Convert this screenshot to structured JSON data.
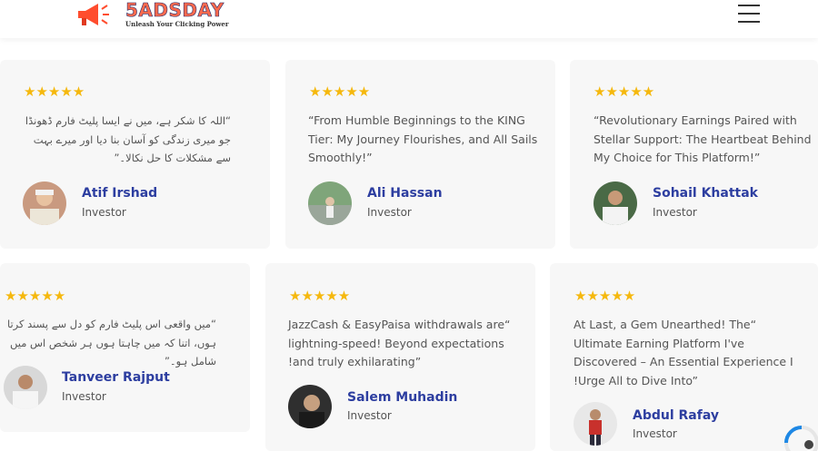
{
  "header": {
    "logo_title": "5ADSDAY",
    "logo_tagline": "Unleash Your Clicking Power",
    "menu_icon": "hamburger-menu-icon"
  },
  "colors": {
    "star": "#f5b80d",
    "name": "#2d3ea0",
    "card_bg": "#f7f7f7",
    "loader": "#1e88e5"
  },
  "testimonials": [
    {
      "rating": "★★★★★",
      "quote": "“اللہ کا شکر ہے، میں نے ایسا پلیٹ فارم ڈھونڈا جو میری زندگی کو آسان بنا دیا اور میرے بہت سے مشکلات کا حل نکالا۔”",
      "name": "Atif Irshad",
      "role": "Investor"
    },
    {
      "rating": "★★★★★",
      "quote": "“From Humble Beginnings to the KING Tier: My Journey Flourishes, and All Sails Smoothly!”",
      "name": "Ali Hassan",
      "role": "Investor"
    },
    {
      "rating": "★★★★★",
      "quote": "“Revolutionary Earnings Paired with Stellar Support: The Heartbeat Behind My Choice for This Platform!”",
      "name": "Sohail Khattak",
      "role": "Investor"
    },
    {
      "rating": "★★★★★",
      "quote": "“میں واقعی اس پلیٹ فارم کو دل سے پسند کرتا ہوں، اتنا کہ میں چاہتا ہوں ہر شخص اس میں شامل ہو۔”",
      "name": "Tanveer Rajput",
      "role": "Investor"
    },
    {
      "rating": "★★★★★",
      "quote": "JazzCash & EasyPaisa withdrawals are“ lightning-speed! Beyond expectations !and truly exhilarating”",
      "name": "Salem Muhadin",
      "role": "Investor"
    },
    {
      "rating": "★★★★★",
      "quote": "At Last, a Gem Unearthed! The“ Ultimate Earning Platform I've Discovered – An Essential Experience I !Urge All to Dive Into”",
      "name": "Abdul Rafay",
      "role": "Investor"
    }
  ]
}
